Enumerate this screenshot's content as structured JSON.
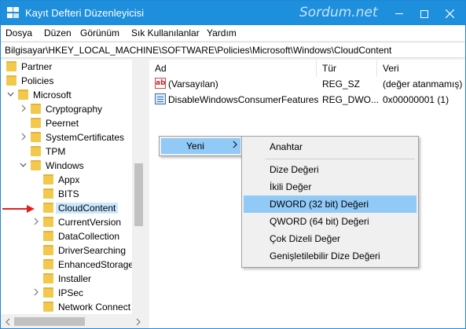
{
  "window": {
    "title": "Kayıt Defteri Düzenleyicisi",
    "watermark": "Sordum.net"
  },
  "menu": [
    {
      "label": "Dosya"
    },
    {
      "label": "Düzen"
    },
    {
      "label": "Görünüm"
    },
    {
      "label": "Sık Kullanılanlar"
    },
    {
      "label": "Yardım"
    }
  ],
  "address": "Bilgisayar\\HKEY_LOCAL_MACHINE\\SOFTWARE\\Policies\\Microsoft\\Windows\\CloudContent",
  "tree": [
    {
      "label": "Partner",
      "expander": ""
    },
    {
      "label": "Policies",
      "expander": ""
    },
    {
      "label": "Microsoft",
      "expander": "v"
    },
    {
      "label": "Cryptography",
      "expander": ">"
    },
    {
      "label": "Peernet",
      "expander": ""
    },
    {
      "label": "SystemCertificates",
      "expander": ">"
    },
    {
      "label": "TPM",
      "expander": ""
    },
    {
      "label": "Windows",
      "expander": "v"
    },
    {
      "label": "Appx",
      "expander": ""
    },
    {
      "label": "BITS",
      "expander": ""
    },
    {
      "label": "CloudContent",
      "expander": "",
      "selected": true
    },
    {
      "label": "CurrentVersion",
      "expander": ">"
    },
    {
      "label": "DataCollection",
      "expander": ""
    },
    {
      "label": "DriverSearching",
      "expander": ""
    },
    {
      "label": "EnhancedStorage",
      "expander": ""
    },
    {
      "label": "Installer",
      "expander": ""
    },
    {
      "label": "IPSec",
      "expander": ">"
    },
    {
      "label": "Network Connect",
      "expander": ""
    }
  ],
  "columns": {
    "name": "Ad",
    "type": "Tür",
    "data": "Veri"
  },
  "values": [
    {
      "name": "(Varsayılan)",
      "type": "REG_SZ",
      "data": "(değer atanmamış)",
      "icon": "string-value-icon"
    },
    {
      "name": "DisableWindowsConsumerFeatures",
      "type": "REG_DWO...",
      "data": "0x00000001 (1)",
      "icon": "dword-value-icon"
    }
  ],
  "context_menu": {
    "new_label": "Yeni",
    "submenu": [
      {
        "label": "Anahtar"
      },
      {
        "label": "Dize Değeri"
      },
      {
        "label": "İkili Değer"
      },
      {
        "label": "DWORD (32 bit) Değeri",
        "highlighted": true
      },
      {
        "label": "QWORD (64 bit) Değeri"
      },
      {
        "label": "Çok Dizeli Değer"
      },
      {
        "label": "Genişletilebilir Dize Değeri"
      }
    ]
  },
  "colors": {
    "titlebar": "#1e8fdc",
    "highlight": "#91c9f7",
    "selection": "#cce8ff",
    "folder": "#f2c94c",
    "annotation_arrow": "#e02020"
  }
}
